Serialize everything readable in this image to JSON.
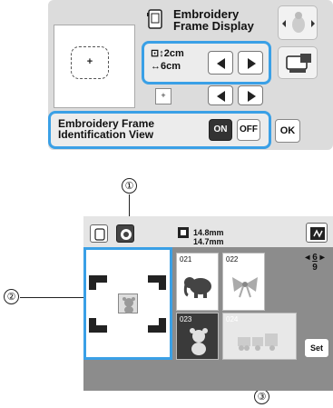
{
  "top_panel": {
    "title": "Embroidery Frame Display",
    "size_values": [
      "2cm",
      "6cm"
    ],
    "identification_label": "Embroidery Frame Identification View",
    "on_label": "ON",
    "off_label": "OFF",
    "ok_label": "OK"
  },
  "callouts": {
    "one": "①",
    "two": "②",
    "three": "③"
  },
  "bottom_panel": {
    "width_value": "14.8mm",
    "height_value": "14.7mm",
    "patterns": [
      {
        "number": "021",
        "motif": "elephant-icon"
      },
      {
        "number": "022",
        "motif": "bow-icon"
      },
      {
        "number": "023",
        "motif": "bear-icon"
      },
      {
        "number": "024",
        "motif": "train-icon"
      }
    ],
    "page_current": "6",
    "page_total": "9",
    "set_label": "Set"
  },
  "colors": {
    "accent_blue": "#3aa0e6",
    "panel_gray": "#dcdcdc",
    "on_button": "#333333"
  }
}
